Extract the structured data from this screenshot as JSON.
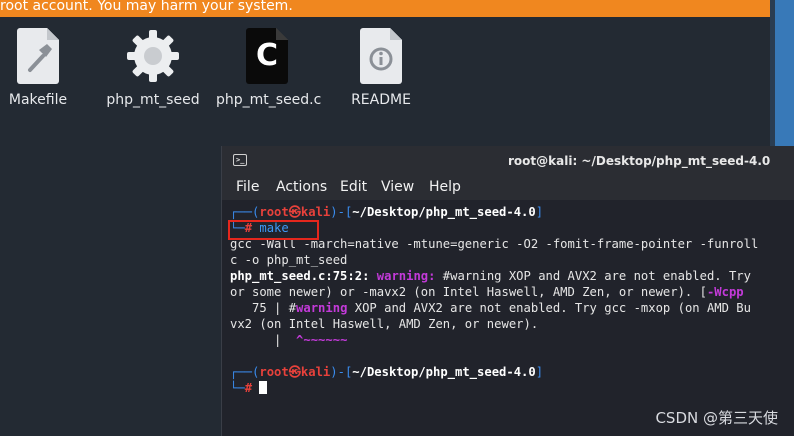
{
  "warning_bar": {
    "text": "root account. You may harm your system."
  },
  "desktop": {
    "icons": [
      {
        "label": "Makefile",
        "icon": "makefile-icon"
      },
      {
        "label": "php_mt_seed",
        "icon": "gear-icon"
      },
      {
        "label": "php_mt_seed.c",
        "icon": "c-source-icon"
      },
      {
        "label": "README",
        "icon": "readme-icon"
      }
    ]
  },
  "terminal": {
    "title": "root@kali: ~/Desktop/php_mt_seed-4.0",
    "menu": [
      "File",
      "Actions",
      "Edit",
      "View",
      "Help"
    ],
    "lines": {
      "p1_user": "root",
      "p1_at": "㉿",
      "p1_host": "kali",
      "p1_path": "~/Desktop/php_mt_seed-4.0",
      "p1_cmd": "make",
      "gcc1": "gcc -Wall -march=native -mtune=generic -O2 -fomit-frame-pointer -funroll",
      "gcc2": "c -o php_mt_seed",
      "w1_file": "php_mt_seed.c:75:2:",
      "w1_word": "warning:",
      "w1_rest": " #warning XOP and AVX2 are not enabled. Try",
      "w2_text": "or some newer) or -mavx2 (on Intel Haswell, AMD Zen, or newer). [",
      "w2_flag": "-Wcpp",
      "w3_pre": "   75 | #",
      "w3_word": "warning",
      "w3_rest": " XOP and AVX2 are not enabled. Try gcc -mxop (on AMD Bu",
      "w4": "vx2 (on Intel Haswell, AMD Zen, or newer).",
      "w5_pre": "      |  ",
      "w5_caret": "^~~~~~~",
      "p2_user": "root",
      "p2_at": "㉿",
      "p2_host": "kali",
      "p2_path": "~/Desktop/php_mt_seed-4.0",
      "p2_hash": "#"
    }
  },
  "watermark": "CSDN @第三天使"
}
